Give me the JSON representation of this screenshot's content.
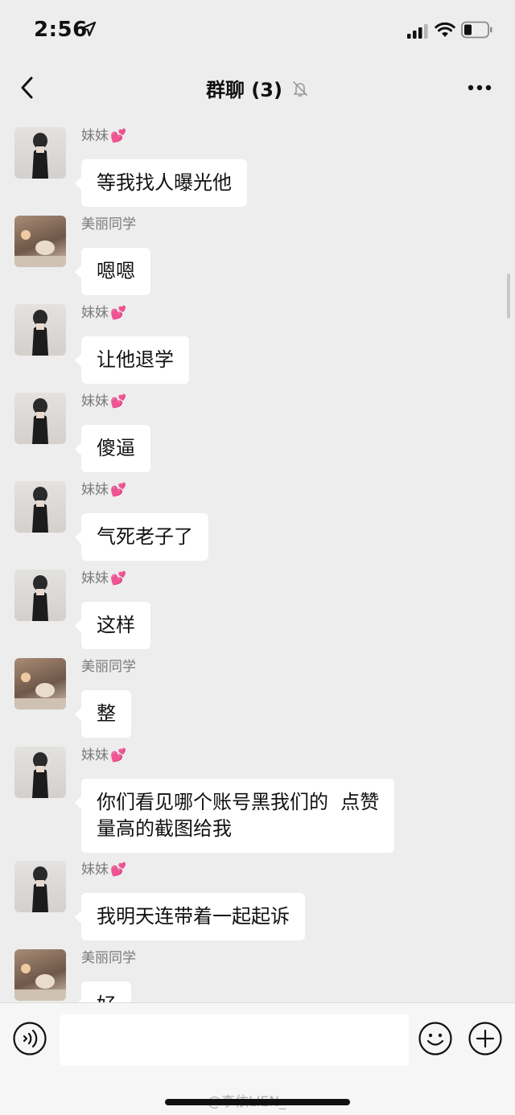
{
  "status_bar": {
    "time": "2:56"
  },
  "nav": {
    "title": "群聊 (3)"
  },
  "messages": [
    {
      "sender": "妹妹",
      "heart": "💕",
      "avatar": "sister",
      "text": "等我找人曝光他"
    },
    {
      "sender": "美丽同学",
      "heart": "",
      "avatar": "classmate",
      "text": "嗯嗯"
    },
    {
      "sender": "妹妹",
      "heart": "💕",
      "avatar": "sister",
      "text": "让他退学"
    },
    {
      "sender": "妹妹",
      "heart": "💕",
      "avatar": "sister",
      "text": "傻逼"
    },
    {
      "sender": "妹妹",
      "heart": "💕",
      "avatar": "sister",
      "text": "气死老子了"
    },
    {
      "sender": "妹妹",
      "heart": "💕",
      "avatar": "sister",
      "text": "这样"
    },
    {
      "sender": "美丽同学",
      "heart": "",
      "avatar": "classmate",
      "text": "整"
    },
    {
      "sender": "妹妹",
      "heart": "💕",
      "avatar": "sister",
      "text": "你们看见哪个账号黑我们的  点赞\n量高的截图给我"
    },
    {
      "sender": "妹妹",
      "heart": "💕",
      "avatar": "sister",
      "text": "我明天连带着一起起诉"
    },
    {
      "sender": "美丽同学",
      "heart": "",
      "avatar": "classmate",
      "text": "好"
    }
  ],
  "input_bar": {
    "placeholder": ""
  },
  "watermark": "@李依LIEN_",
  "colors": {
    "background": "#ededed",
    "bubble": "#ffffff",
    "heart": "#f0609b"
  }
}
